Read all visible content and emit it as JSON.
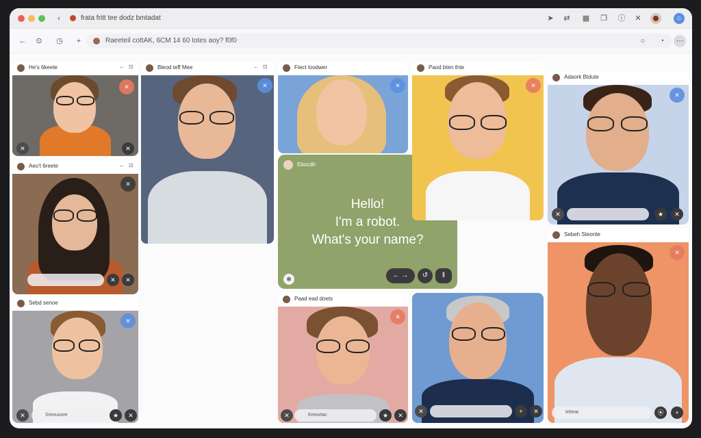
{
  "window": {
    "title": "frata fritt tee dodz bmtadat",
    "colors": {
      "close": "#ee5e5a",
      "minimize": "#f4bd4f",
      "zoom": "#5dc251",
      "accent": "#5b8fe0"
    }
  },
  "address_bar": {
    "url": "Raeeteil cottAK, 6CM 14 60 totes aoy? f0f0"
  },
  "participants": [
    {
      "name": "He's 6keete"
    },
    {
      "name": "Aeo't 6reete"
    },
    {
      "name": "Sebd senoe",
      "pill": "Sreouoore"
    },
    {
      "name": "Bleod teff Mee"
    },
    {
      "name": "Ftect loodwer"
    },
    {
      "name": "Paad ead doets",
      "pill": "Kreovtac"
    },
    {
      "name": "Paod bten thte"
    },
    {
      "name": "Adaork Btdute"
    },
    {
      "name": "Sebeh Steonte",
      "pill": "Ielteat"
    }
  ],
  "robot": {
    "speaker": "Ebocdh",
    "message_lines": [
      "Hello!",
      "I'm a robot.",
      "What's your name?"
    ]
  },
  "icons": [
    "back-icon",
    "share-icon",
    "bell-icon",
    "settings-icon",
    "close-icon",
    "refresh-icon",
    "mic-icon",
    "camera-icon",
    "more-icon",
    "plus-icon"
  ]
}
